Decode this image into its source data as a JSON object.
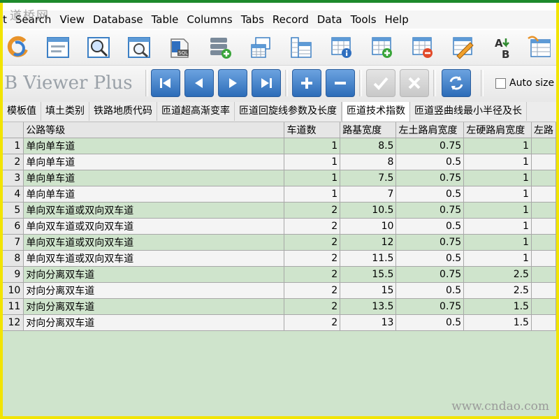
{
  "watermarks": {
    "top_left": "道桥网",
    "bottom_right": "www.cndao.com"
  },
  "menu": [
    "t",
    "Search",
    "View",
    "Database",
    "Table",
    "Columns",
    "Tabs",
    "Record",
    "Data",
    "Tools",
    "Help"
  ],
  "toolbar_icons": [
    "refresh-icon",
    "form-icon",
    "search-zoom-icon",
    "search-page-icon",
    "sql-icon",
    "add-database-icon",
    "tables-icon",
    "table-columns-icon",
    "table-info-icon",
    "add-record-icon",
    "delete-record-icon",
    "edit-icon",
    "rename-icon",
    "export-icon"
  ],
  "app_title": "B Viewer Plus",
  "nav_buttons": [
    "first-record",
    "previous-record",
    "next-record",
    "last-record",
    "add-record",
    "delete-record",
    "post-edit",
    "cancel-edit",
    "refresh"
  ],
  "auto_size_label": "Auto size",
  "tabs": [
    "模板值",
    "填土类别",
    "铁路地质代码",
    "匝道超高渐变率",
    "匝道回旋线参数及长度",
    "匝道技术指数",
    "匝道竖曲线最小半径及长"
  ],
  "active_tab_index": 5,
  "table": {
    "columns": [
      "公路等级",
      "车道数",
      "路基宽度",
      "左土路肩宽度",
      "左硬路肩宽度",
      "左路"
    ],
    "rows": [
      {
        "n": "1",
        "c": [
          "单向单车道",
          "1",
          "8.5",
          "0.75",
          "1",
          ""
        ]
      },
      {
        "n": "2",
        "c": [
          "单向单车道",
          "1",
          "8",
          "0.5",
          "1",
          ""
        ]
      },
      {
        "n": "3",
        "c": [
          "单向单车道",
          "1",
          "7.5",
          "0.75",
          "1",
          ""
        ]
      },
      {
        "n": "4",
        "c": [
          "单向单车道",
          "1",
          "7",
          "0.5",
          "1",
          ""
        ]
      },
      {
        "n": "5",
        "c": [
          "单向双车道或双向双车道",
          "2",
          "10.5",
          "0.75",
          "1",
          ""
        ]
      },
      {
        "n": "6",
        "c": [
          "单向双车道或双向双车道",
          "2",
          "10",
          "0.5",
          "1",
          ""
        ]
      },
      {
        "n": "7",
        "c": [
          "单向双车道或双向双车道",
          "2",
          "12",
          "0.75",
          "1",
          ""
        ]
      },
      {
        "n": "8",
        "c": [
          "单向双车道或双向双车道",
          "2",
          "11.5",
          "0.5",
          "1",
          ""
        ]
      },
      {
        "n": "9",
        "c": [
          "对向分离双车道",
          "2",
          "15.5",
          "0.75",
          "2.5",
          ""
        ]
      },
      {
        "n": "10",
        "c": [
          "对向分离双车道",
          "2",
          "15",
          "0.5",
          "2.5",
          ""
        ]
      },
      {
        "n": "11",
        "c": [
          "对向分离双车道",
          "2",
          "13.5",
          "0.75",
          "1.5",
          ""
        ]
      },
      {
        "n": "12",
        "c": [
          "对向分离双车道",
          "2",
          "13",
          "0.5",
          "1.5",
          ""
        ]
      }
    ]
  }
}
